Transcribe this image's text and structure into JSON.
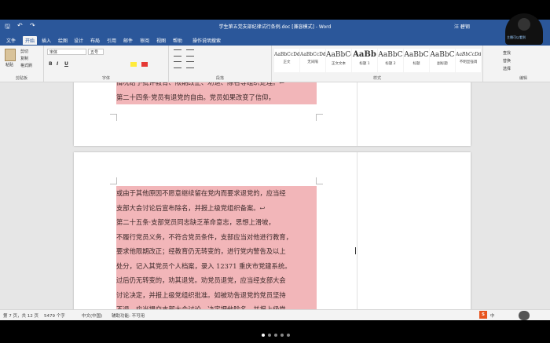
{
  "titlebar": {
    "title": "学生第五党支部纪律试行条例.doc [兼容模式] - Word",
    "user": "汪 碧钢",
    "qa_save": "🖫",
    "qa_undo": "↶",
    "qa_redo": "↷"
  },
  "tabs": [
    "文件",
    "开始",
    "插入",
    "绘图",
    "设计",
    "布局",
    "引用",
    "邮件",
    "审阅",
    "视图",
    "帮助",
    "操作说明搜索"
  ],
  "ribbon": {
    "clipboard": {
      "paste": "粘贴",
      "cut": "剪切",
      "copy": "复制",
      "format_painter": "格式刷",
      "label": "剪贴板"
    },
    "font": {
      "name": "宋体",
      "size": "五号",
      "label": "字体",
      "bold": "B",
      "italic": "I",
      "underline": "U"
    },
    "paragraph": {
      "label": "段落"
    },
    "styles": {
      "label": "样式",
      "items": [
        {
          "sample": "AaBbCcDd",
          "name": "正文"
        },
        {
          "sample": "AaBbCcDd",
          "name": "无间隔"
        },
        {
          "sample": "AaBbCc",
          "name": "正文文本"
        },
        {
          "sample": "AaBb",
          "name": "标题 1"
        },
        {
          "sample": "AaBbC",
          "name": "标题 2"
        },
        {
          "sample": "AaBbC",
          "name": "标题"
        },
        {
          "sample": "AaBbC",
          "name": "副标题"
        },
        {
          "sample": "AaBbCcDd",
          "name": "不明显强调"
        }
      ]
    },
    "editing": {
      "find": "查找",
      "replace": "替换",
      "select": "选择",
      "label": "编辑"
    }
  },
  "document": {
    "page1_lines": [
      "情况给予批评教育、限期改正、劝退、除名等组织处理。↩",
      "    第二十四条·党员有退党的自由。党员如果改变了信仰，"
    ],
    "page2_lines": [
      "或由于其他原因不愿意继续留在党内而要求退党的，应当经",
      "支部大会讨论后宣布除名，并报上级党组织备案。↩",
      "    第二十五条·支部党员同志缺乏革命意志，思想上滑坡，",
      "不履行党员义务，不符合党员条件，支部应当对他进行教育，",
      "要求他限期改正；经教育仍无转变的，进行党内警告及以上",
      "处分，记入其党员个人档案，录入 12371 重庆市党建系统。",
      "过后仍无转变的，劝其退党。劝党员退党，应当经支部大会",
      "讨论决定，并报上级党组织批准。如被劝告退党的党员坚持",
      "不退，应当提交支部大会讨论，决定把他除名，并报上级党"
    ]
  },
  "status": {
    "page": "第 7 页，共 12 页",
    "words": "5479 个字",
    "lang": "中文(中国)",
    "accessibility": "辅助功能: 不可用"
  },
  "tray": {
    "ime": "S",
    "ime_label": "中"
  },
  "camera_overlay": "主播可以看到"
}
